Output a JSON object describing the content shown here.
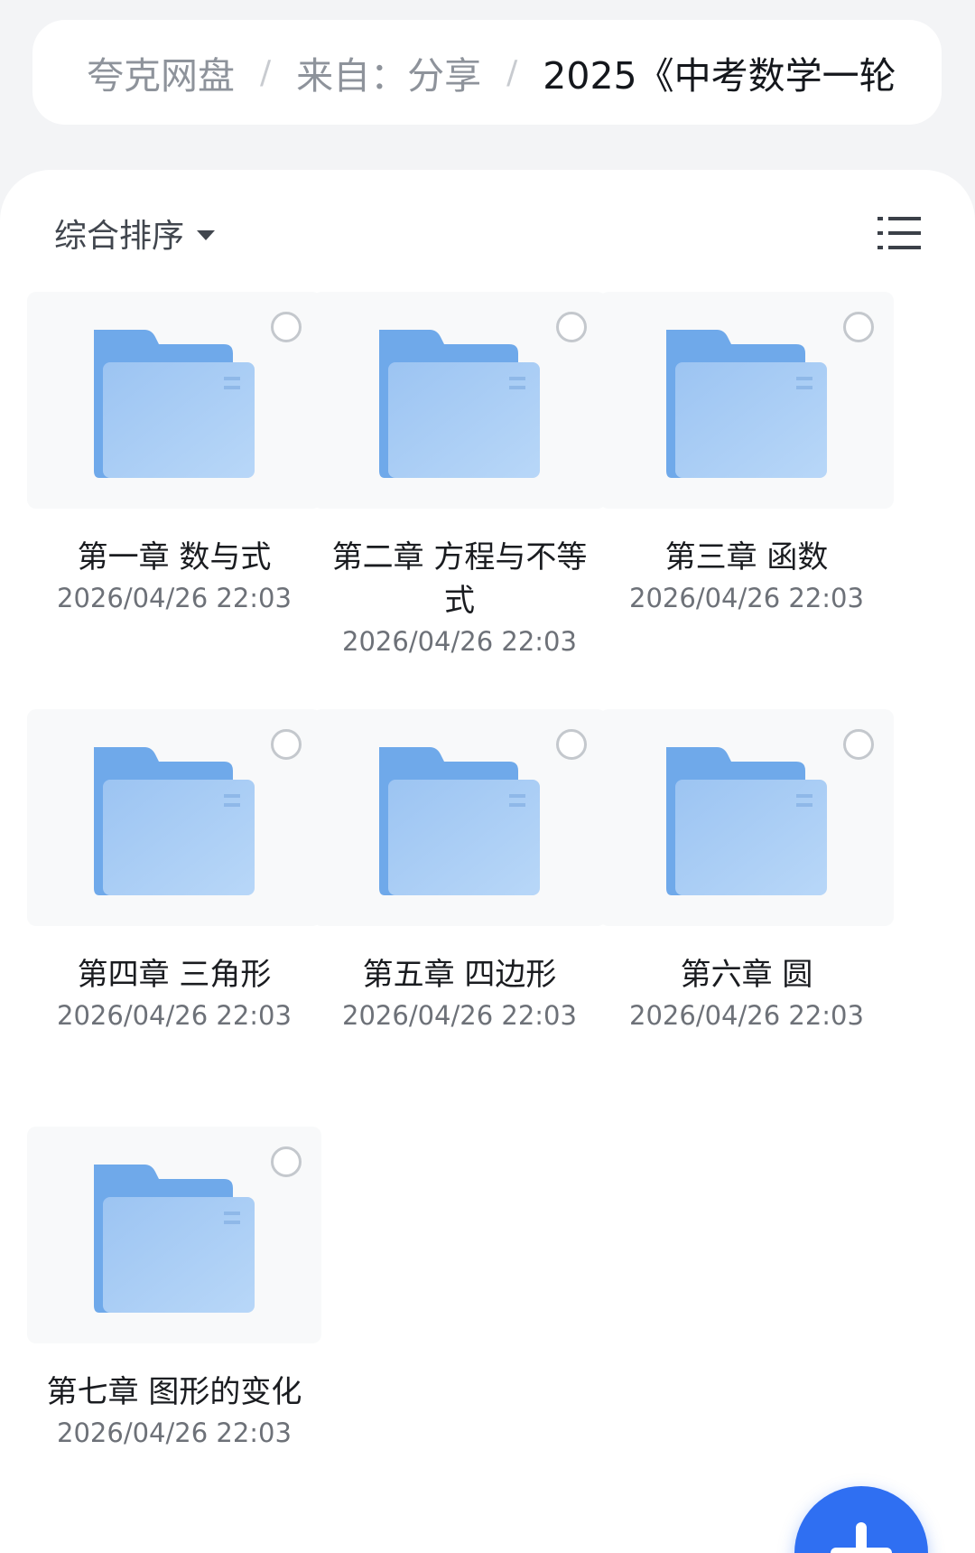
{
  "breadcrumb": {
    "items": [
      {
        "label": "夸克网盘"
      },
      {
        "label": "来自：分享"
      },
      {
        "label": "2025《中考数学一轮"
      }
    ],
    "separator": "/"
  },
  "toolbar": {
    "sort_label": "综合排序",
    "view_icon": "list-view-icon"
  },
  "folders": [
    {
      "name": "第一章 数与式",
      "date": "2026/04/26 22:03"
    },
    {
      "name": "第二章 方程与不等式",
      "date": "2026/04/26 22:03"
    },
    {
      "name": "第三章 函数",
      "date": "2026/04/26 22:03"
    },
    {
      "name": "第四章 三角形",
      "date": "2026/04/26 22:03"
    },
    {
      "name": "第五章 四边形",
      "date": "2026/04/26 22:03"
    },
    {
      "name": "第六章 圆",
      "date": "2026/04/26 22:03"
    },
    {
      "name": "第七章 图形的变化",
      "date": "2026/04/26 22:03"
    }
  ],
  "fab": {
    "icon": "plus-icon"
  },
  "colors": {
    "accent": "#2f6ff2",
    "folder_back": "#6fa9ea",
    "folder_front": "#a8cdf6",
    "page_bg": "#f3f4f6"
  }
}
